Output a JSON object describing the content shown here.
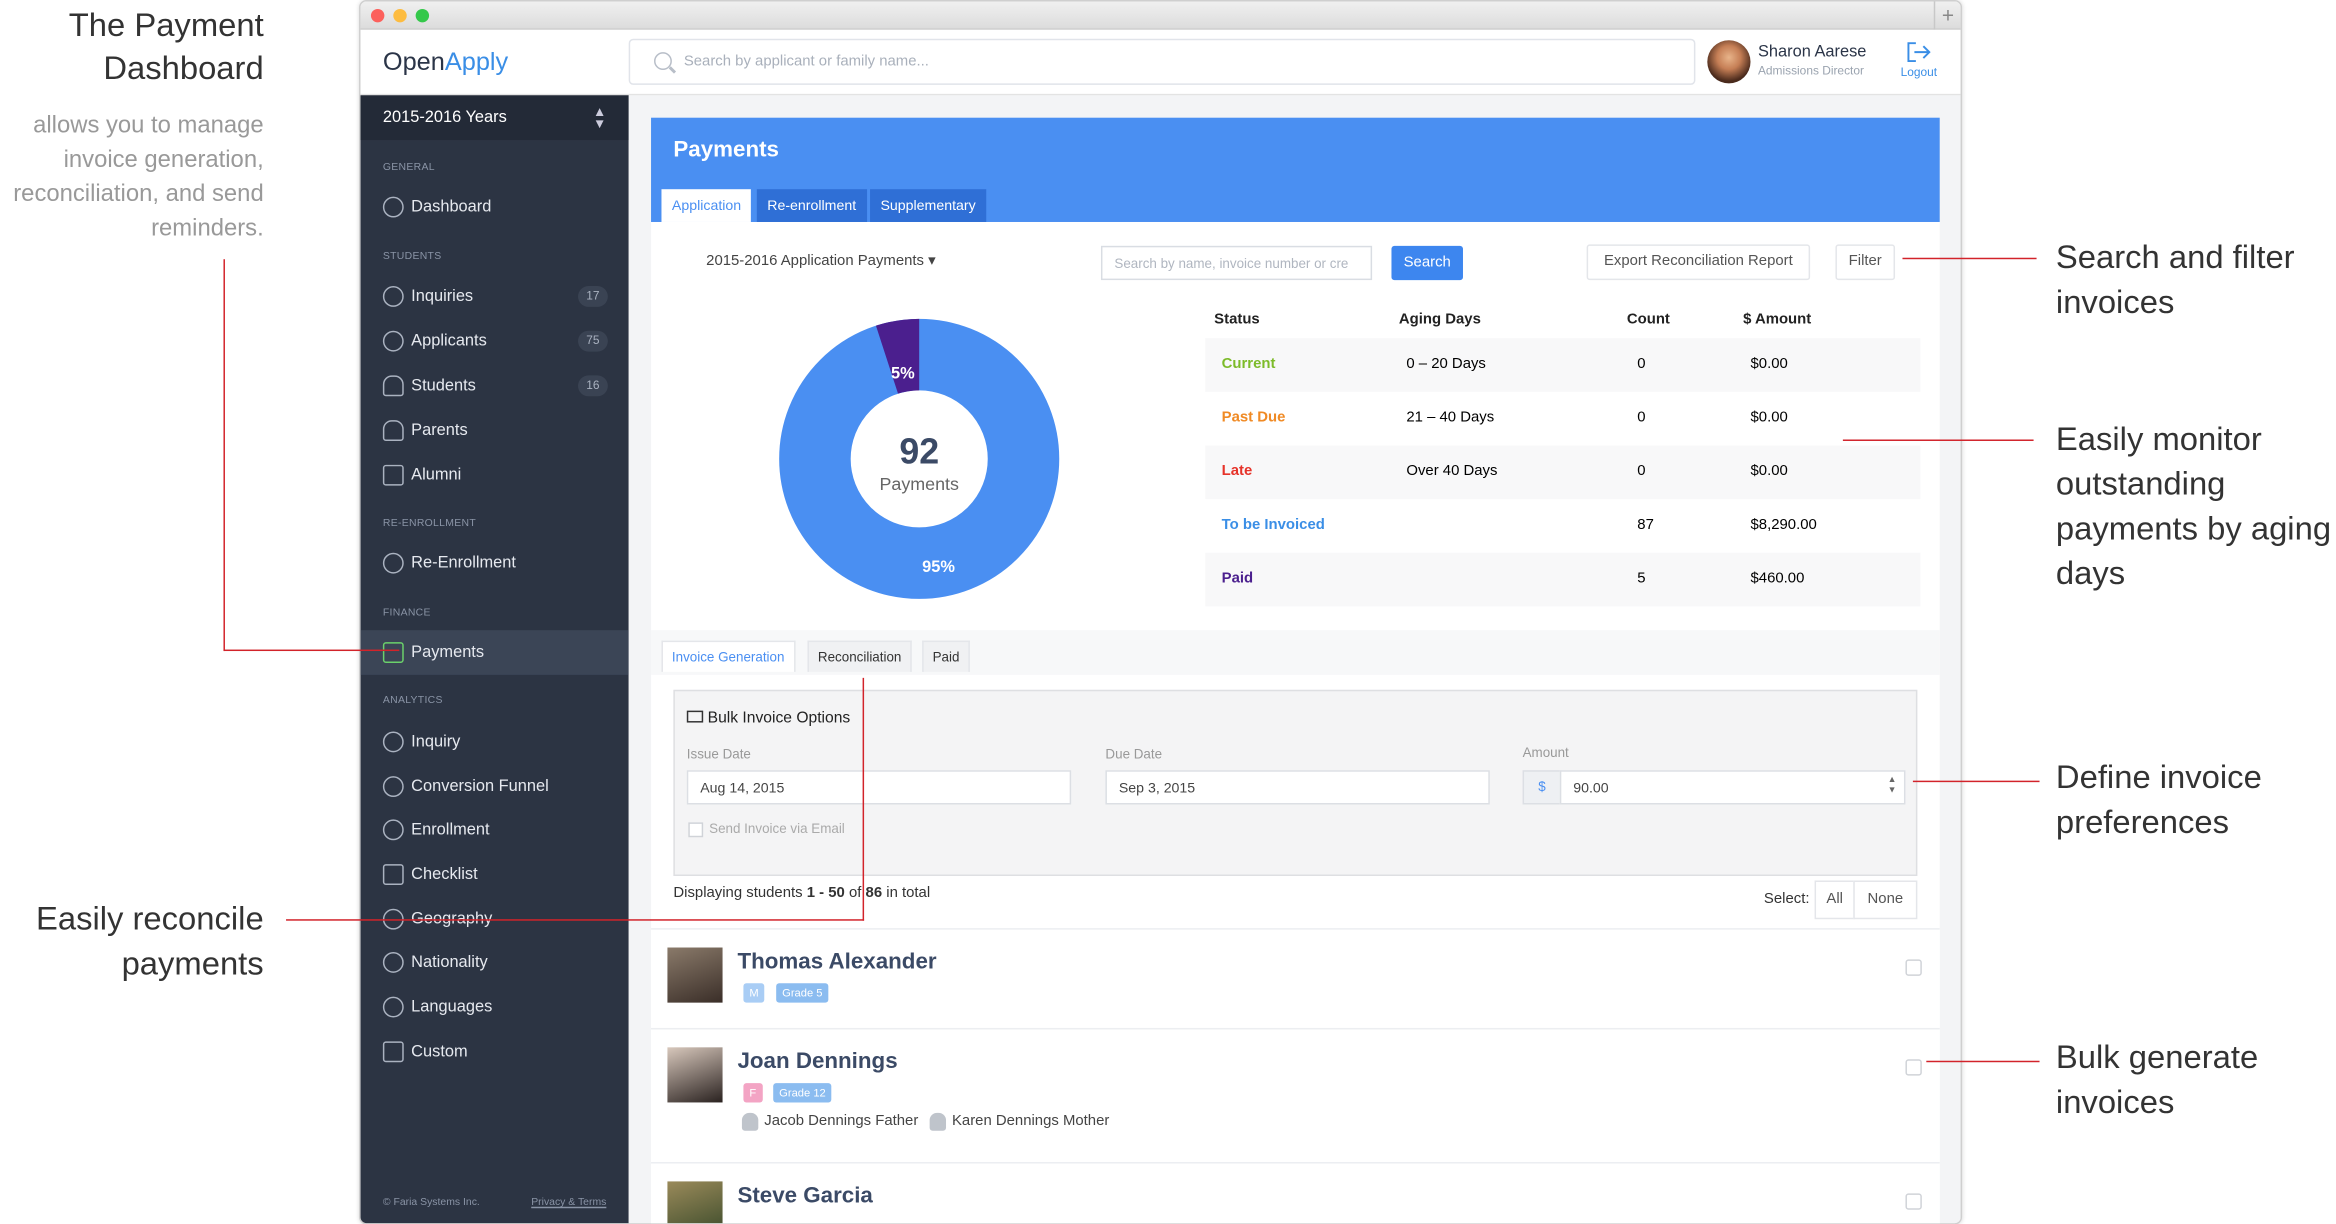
{
  "callouts": {
    "title": "The Payment Dashboard",
    "subtitle": "allows you to manage invoice generation, reconciliation, and send reminders.",
    "search_filter": "Search and filter invoices",
    "monitor": "Easily monitor outstanding payments by aging days",
    "define": "Define invoice preferences",
    "reconcile": "Easily reconcile payments",
    "bulk": "Bulk generate invoices"
  },
  "app": {
    "logo_a": "Open",
    "logo_b": "Apply",
    "search_placeholder": "Search by applicant or family name...",
    "user_name": "Sharon Aarese",
    "user_role": "Admissions Director",
    "logout": "Logout"
  },
  "sidebar": {
    "year": "2015-2016 Years",
    "sections": {
      "general": "GENERAL",
      "students": "STUDENTS",
      "reenroll": "RE-ENROLLMENT",
      "finance": "FINANCE",
      "analytics": "ANALYTICS"
    },
    "items": [
      {
        "label": "Dashboard"
      },
      {
        "label": "Inquiries",
        "count": "17"
      },
      {
        "label": "Applicants",
        "count": "75"
      },
      {
        "label": "Students",
        "count": "16"
      },
      {
        "label": "Parents"
      },
      {
        "label": "Alumni"
      },
      {
        "label": "Re-Enrollment"
      },
      {
        "label": "Payments"
      },
      {
        "label": "Inquiry"
      },
      {
        "label": "Conversion Funnel"
      },
      {
        "label": "Enrollment"
      },
      {
        "label": "Checklist"
      },
      {
        "label": "Geography"
      },
      {
        "label": "Nationality"
      },
      {
        "label": "Languages"
      },
      {
        "label": "Custom"
      }
    ],
    "footer_left": "© Faria Systems Inc.",
    "footer_right": "Privacy & Terms"
  },
  "payments": {
    "title": "Payments",
    "tabs": [
      "Application",
      "Re-enrollment",
      "Supplementary"
    ],
    "period": "2015-2016 Application Payments ▾",
    "search_placeholder": "Search by name, invoice number or cre",
    "search_btn": "Search",
    "export_btn": "Export Reconciliation Report",
    "filter_btn": "Filter",
    "donut": {
      "total": "92",
      "label": "Payments",
      "paid_pct_label": "5%",
      "other_pct_label": "95%",
      "paid_fraction": 0.05,
      "color_main": "#4a8ff2",
      "color_paid": "#4b1f8e"
    },
    "status_headers": [
      "Status",
      "Aging Days",
      "Count",
      "$ Amount"
    ],
    "status_rows": [
      {
        "status": "Current",
        "aging": "0 – 20 Days",
        "count": "0",
        "amount": "$0.00",
        "color": "#7dbb2a"
      },
      {
        "status": "Past Due",
        "aging": "21 – 40 Days",
        "count": "0",
        "amount": "$0.00",
        "color": "#f08a24"
      },
      {
        "status": "Late",
        "aging": "Over 40 Days",
        "count": "0",
        "amount": "$0.00",
        "color": "#e6332a"
      },
      {
        "status": "To be Invoiced",
        "aging": "",
        "count": "87",
        "amount": "$8,290.00",
        "color": "#3a8ee6"
      },
      {
        "status": "Paid",
        "aging": "",
        "count": "5",
        "amount": "$460.00",
        "color": "#4b1f8e"
      }
    ],
    "invoice_tabs": [
      "Invoice Generation",
      "Reconciliation",
      "Paid"
    ],
    "bulk": {
      "title": "Bulk Invoice Options",
      "issue_label": "Issue Date",
      "issue_value": "Aug 14, 2015",
      "due_label": "Due Date",
      "due_value": "Sep 3, 2015",
      "amount_label": "Amount",
      "currency": "$",
      "amount_value": "90.00",
      "send_label": "Send Invoice via Email"
    },
    "displaying_prefix": "Displaying students ",
    "displaying_range": "1 - 50",
    "displaying_of": " of ",
    "displaying_total": "86",
    "displaying_suffix": " in total",
    "select_label": "Select:",
    "select_all": "All",
    "select_none": "None",
    "students": [
      {
        "name": "Thomas Alexander",
        "gender": "M",
        "grade": "Grade 5"
      },
      {
        "name": "Joan Dennings",
        "gender": "F",
        "grade": "Grade 12",
        "parents": [
          "Jacob Dennings Father",
          "Karen Dennings Mother"
        ]
      },
      {
        "name": "Steve Garcia"
      }
    ]
  }
}
